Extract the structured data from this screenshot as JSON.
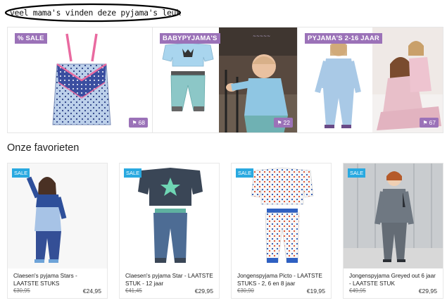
{
  "headline": "veel mama's vinden deze pyjama's leuk",
  "categories": [
    {
      "label": "% SALE",
      "count": "68"
    },
    {
      "label": "BABYPYJAMA'S",
      "count": "22"
    },
    {
      "label": "PYJAMA'S 2-16 JAAR",
      "count": "67"
    }
  ],
  "favorites_title": "Onze favorieten",
  "products": [
    {
      "badge": "SALE",
      "title": "Claesen's pyjama Stars - LAATSTE STUKS",
      "old_price": "€30,95",
      "price": "€24,95"
    },
    {
      "badge": "SALE",
      "title": "Claesen's pyjama Star - LAATSTE STUK - 12 jaar",
      "old_price": "€41,45",
      "price": "€29,95"
    },
    {
      "badge": "SALE",
      "title": "Jongenspyjama Picto - LAATSTE STUKS - 2, 6 en 8 jaar",
      "old_price": "€30,90",
      "price": "€19,95"
    },
    {
      "badge": "SALE",
      "title": "Jongenspyjama Greyed out 6 jaar - LAATSTE STUK",
      "old_price": "€49,95",
      "price": "€29,95"
    }
  ],
  "colors": {
    "category_badge": "#9b72b8",
    "sale_badge": "#29a9e0"
  },
  "icons": [
    "tag-icon"
  ]
}
